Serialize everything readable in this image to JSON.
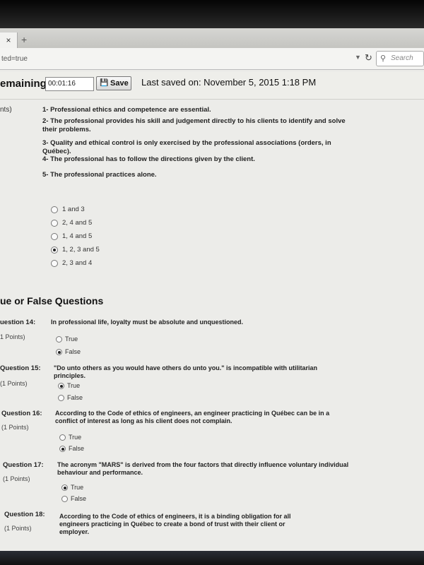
{
  "browser": {
    "tab_close_icon": "×",
    "new_tab_icon": "+",
    "url_fragment": "ted=true",
    "search_placeholder": "Search"
  },
  "quiz": {
    "time_remaining_label": "emaining:",
    "timer_value": "00:01:16",
    "save_label": "Save",
    "last_saved": "Last saved on: November 5, 2015 1:18 PM"
  },
  "q13": {
    "points": "nts)",
    "statements": [
      "1- Professional ethics and competence are essential.",
      "2- The professional provides his skill and judgement directly to his clients to identify and solve their problems.",
      "3- Quality and ethical control is only exercised by the professional associations (orders, in Québec).",
      "4- The professional has to follow the directions given by the client.",
      "5- The professional practices alone."
    ],
    "options": [
      {
        "label": "1 and 3",
        "selected": false
      },
      {
        "label": "2, 4 and 5",
        "selected": false
      },
      {
        "label": "1, 4 and 5",
        "selected": false
      },
      {
        "label": "1, 2, 3 and 5",
        "selected": true
      },
      {
        "label": "2, 3 and 4",
        "selected": false
      }
    ]
  },
  "section_title": "ue or False Questions",
  "questions": [
    {
      "label": "uestion 14:",
      "points": "1 Points)",
      "text": "In professional life, loyalty must be absolute and unquestioned.",
      "options": [
        {
          "label": "True",
          "selected": false
        },
        {
          "label": "False",
          "selected": true
        }
      ]
    },
    {
      "label": "Question 15:",
      "points": "(1 Points)",
      "text": "\"Do unto others as you would have others do unto you.\" is incompatible with utilitarian principles.",
      "options": [
        {
          "label": "True",
          "selected": true
        },
        {
          "label": "False",
          "selected": false
        }
      ]
    },
    {
      "label": "Question 16:",
      "points": "(1 Points)",
      "text": "According to the Code of ethics of engineers, an engineer practicing in Québec can be in a conflict of interest as long as his client does not complain.",
      "options": [
        {
          "label": "True",
          "selected": false
        },
        {
          "label": "False",
          "selected": true
        }
      ]
    },
    {
      "label": "Question 17:",
      "points": "(1 Points)",
      "text": "The acronym \"MARS\" is derived from the four factors that directly influence voluntary individual behaviour and performance.",
      "options": [
        {
          "label": "True",
          "selected": true
        },
        {
          "label": "False",
          "selected": false
        }
      ]
    },
    {
      "label": "Question 18:",
      "points": "(1 Points)",
      "text": "According to the Code of ethics of engineers, it is a binding obligation for all engineers practicing in Québec to create a bond of trust with their client or employer.",
      "options": []
    }
  ]
}
